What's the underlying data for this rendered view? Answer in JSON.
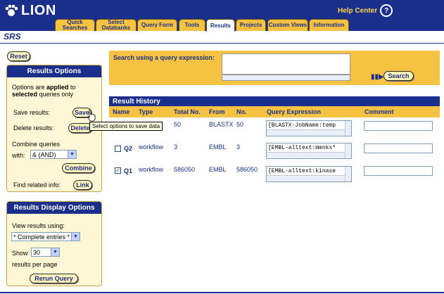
{
  "app": {
    "logo_text": "LION",
    "section": "SRS",
    "help_label": "Help Center"
  },
  "tabs": [
    {
      "label": "Quick Searches",
      "active": false
    },
    {
      "label": "Select Databanks",
      "active": false
    },
    {
      "label": "Query Form",
      "active": false
    },
    {
      "label": "Tools",
      "active": false
    },
    {
      "label": "Results",
      "active": true
    },
    {
      "label": "Projects",
      "active": false
    },
    {
      "label": "Custom Views",
      "active": false
    },
    {
      "label": "Information",
      "active": false
    }
  ],
  "reset_label": "Reset",
  "results_options": {
    "title": "Results Options",
    "info_pre": "Options are ",
    "info_applied": "applied",
    "info_mid": " to",
    "info_selected": "selected",
    "info_post": " queries only",
    "save_label": "Save results:",
    "save_button": "Save",
    "delete_label": "Delete results:",
    "delete_button": "Delete",
    "combine_label": "Combine queries",
    "with_label": "with:",
    "with_value": "& (AND)",
    "combine_button": "Combine",
    "related_label": "Find related info:",
    "link_button": "Link"
  },
  "display_options": {
    "title": "Results Display Options",
    "view_label": "View results using:",
    "view_value": "* Complete entries *",
    "show_label": "Show",
    "show_value": "30",
    "per_page_label": "results per page",
    "rerun_button": "Rerun Query"
  },
  "query": {
    "label": "Search using a query expression:",
    "value": "",
    "search_button": "Search"
  },
  "history": {
    "title": "Result History",
    "columns": [
      "Name",
      "Type",
      "Total No.",
      "From",
      "No.",
      "Query Expression",
      "Comment"
    ],
    "rows": [
      {
        "name": "",
        "type": "",
        "total": "50",
        "from": "BLASTX",
        "no": "50",
        "expr": "[BLASTX-JobName:temp",
        "checked": false,
        "has_checkbox": false
      },
      {
        "name": "Q2",
        "type": "workflow",
        "total": "3",
        "from": "EMBL",
        "no": "3",
        "expr": "[EMBL-alltext:mmnkx*",
        "checked": false,
        "has_checkbox": true
      },
      {
        "name": "Q1",
        "type": "workflow",
        "total": "586050",
        "from": "EMBL",
        "no": "586050",
        "expr": "[EMBL-alltext:kinase",
        "checked": true,
        "has_checkbox": true
      }
    ]
  },
  "tooltip": "Select options to save data",
  "colors": {
    "header_blue": "#1a2f8c",
    "tab_gold": "#f5c242",
    "panel_bg": "#fff7d6"
  }
}
